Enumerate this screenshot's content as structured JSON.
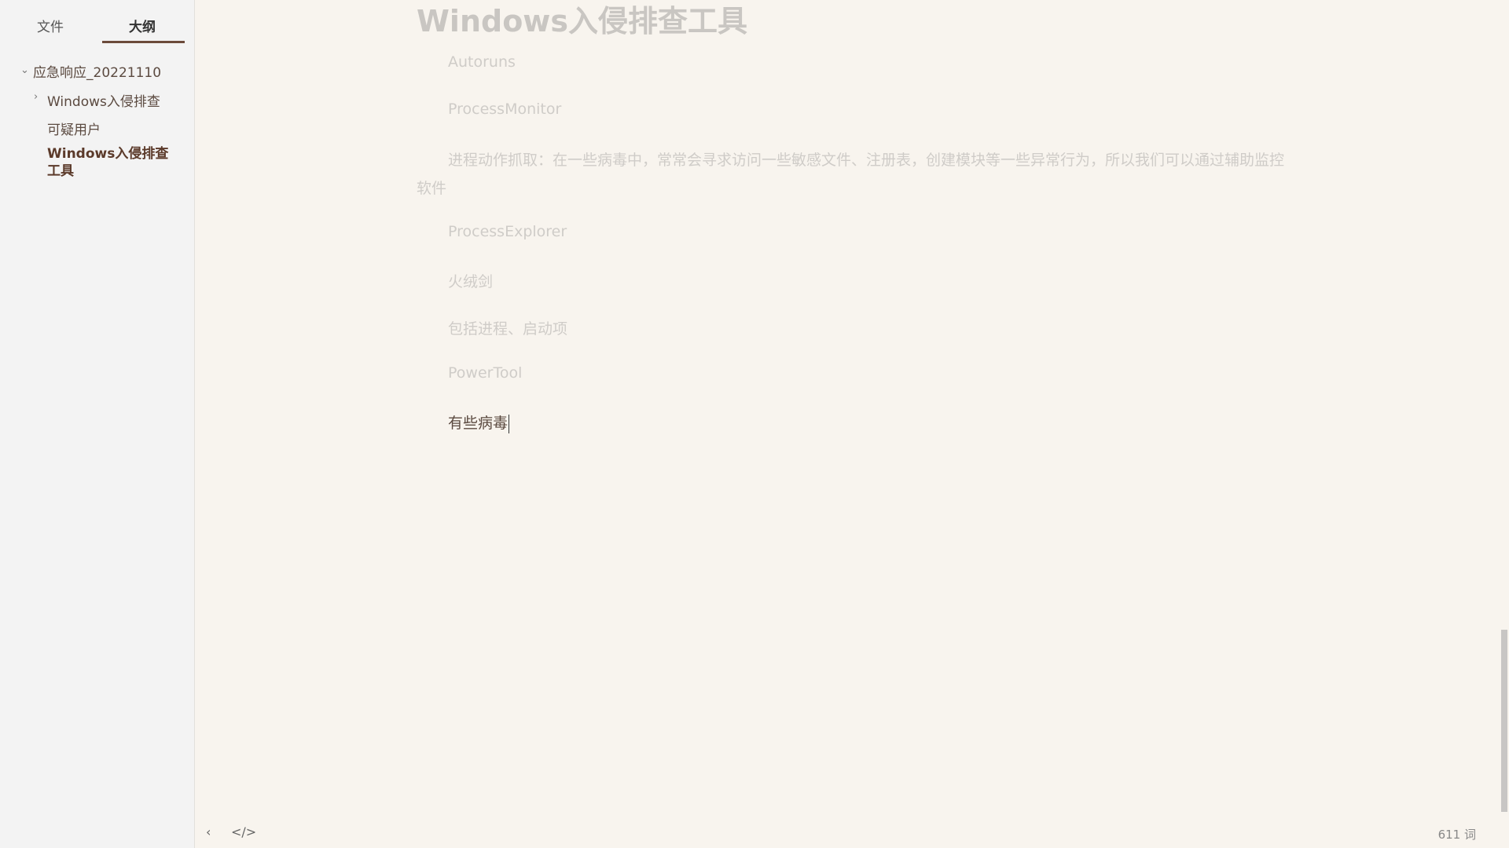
{
  "sidebar": {
    "tabs": [
      {
        "label": "文件"
      },
      {
        "label": "大纲"
      }
    ],
    "outline": [
      {
        "label": "应急响应_20221110"
      },
      {
        "label": "Windows入侵排查"
      },
      {
        "label": "可疑用户"
      },
      {
        "label": "Windows入侵排查工具"
      }
    ]
  },
  "document": {
    "title": "Windows入侵排查工具",
    "paragraphs": [
      "Autoruns",
      "ProcessMonitor",
      "进程动作抓取：在一些病毒中，常常会寻求访问一些敏感文件、注册表，创建模块等一些异常行为，所以我们可以通过辅助监控软件",
      "ProcessExplorer",
      "火绒剑",
      "包括进程、启动项",
      "PowerTool",
      "有些病毒"
    ]
  },
  "footer": {
    "word_count": "611 词"
  },
  "icons": {
    "expand": "chevron-down-icon",
    "collapse": "chevron-right-icon",
    "back": "chevron-left-icon",
    "source": "code-icon"
  },
  "colors": {
    "accent": "#6b4a3a",
    "background": "#f8f4ee",
    "sidebar": "#f3f3f3"
  }
}
